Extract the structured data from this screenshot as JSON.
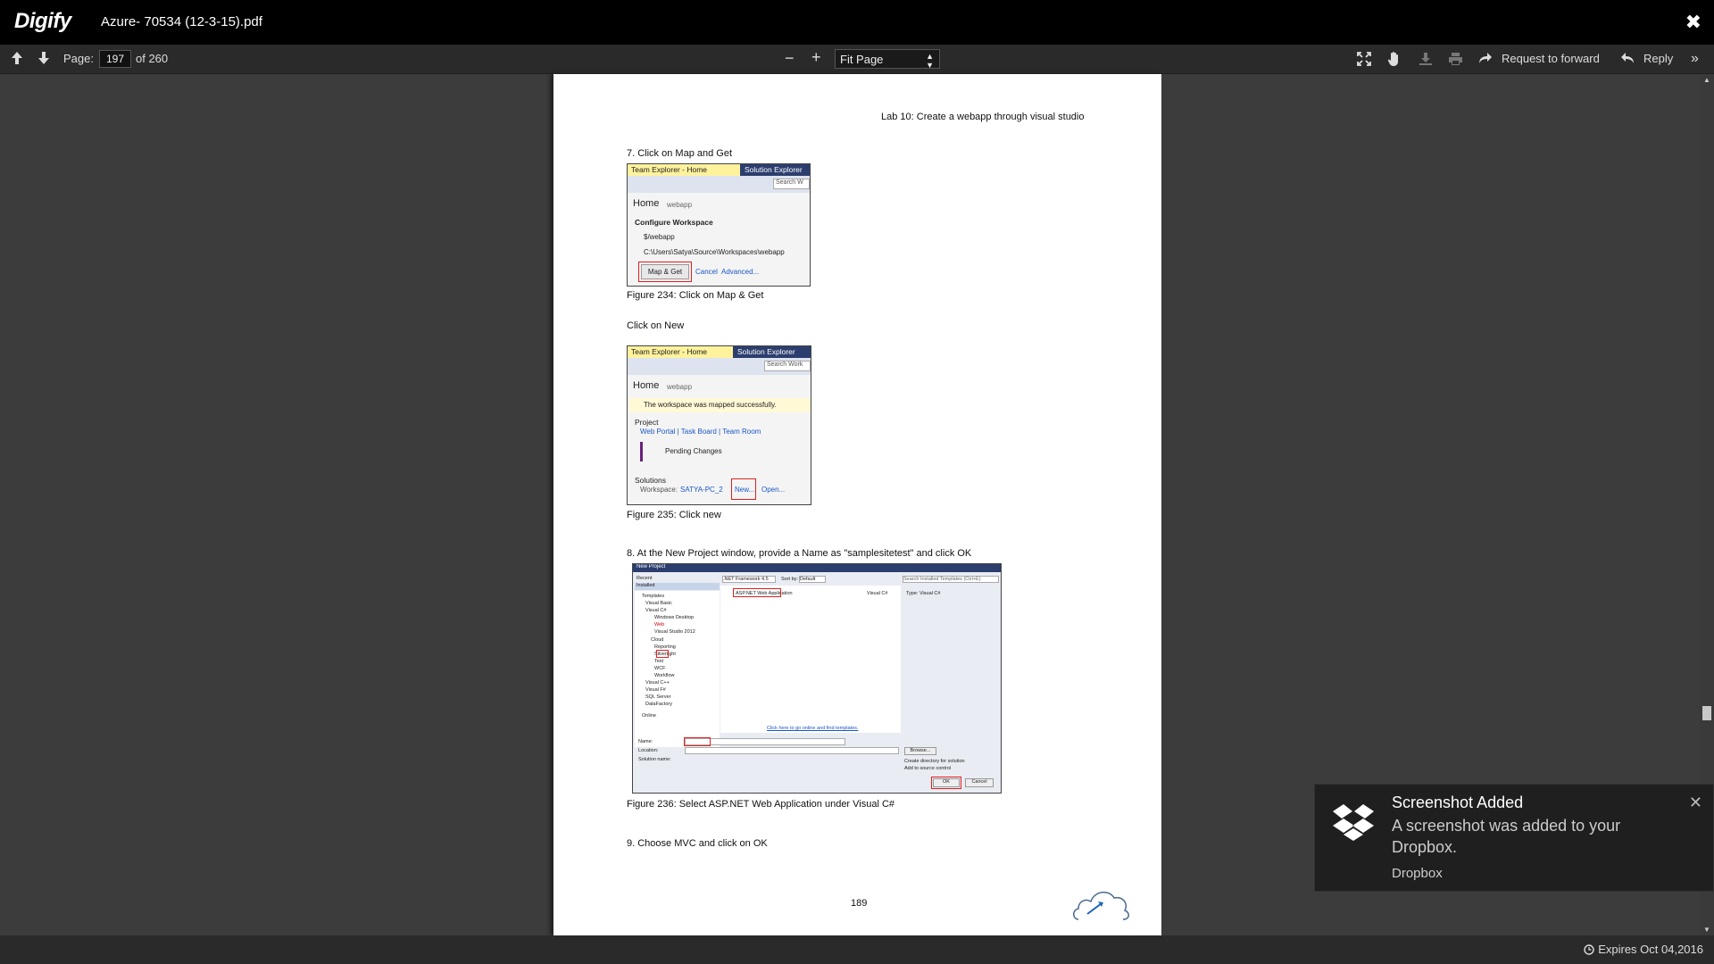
{
  "app": {
    "logo": "Digify",
    "file_title": "Azure- 70534 (12-3-15).pdf",
    "close_icon": "close-x-icon"
  },
  "toolbar": {
    "page_label": "Page:",
    "page_value": "197",
    "page_total": "of 260",
    "zoom_out": "−",
    "zoom_in": "+",
    "fit_mode": "Fit Page",
    "request_forward": "Request to forward",
    "reply": "Reply"
  },
  "document": {
    "header": "Lab 10: Create a webapp through visual studio",
    "step7": "7.    Click on Map and Get",
    "fig234": "Figure 234: Click on Map & Get",
    "click_new": "Click on New",
    "fig235": "Figure 235: Click new",
    "step8": "8.    At the New Project window, provide a Name as \"samplesitetest\" and click OK",
    "fig236": "Figure 236: Select ASP.NET Web Application under Visual C#",
    "step9": "9.    Choose MVC and click on OK",
    "page_number": "189",
    "shot1": {
      "tab_active": "Team Explorer - Home",
      "tab_other": "Solution Explorer",
      "search": "Search W",
      "home": "Home",
      "home_sub": "webapp",
      "section": "Configure Workspace",
      "path1": "$/webapp",
      "path2": "C:\\Users\\Satya\\Source\\Workspaces\\webapp",
      "btn": "Map & Get",
      "cancel": "Cancel",
      "advanced": "Advanced..."
    },
    "shot2": {
      "tab_active": "Team Explorer - Home",
      "tab_other": "Solution Explorer",
      "search": "Search Work",
      "home": "Home",
      "home_sub": "webapp",
      "info": "The workspace was mapped successfully.",
      "project": "Project",
      "links": "Web Portal | Task Board | Team Room",
      "pending": "Pending Changes",
      "solutions": "Solutions",
      "workspace_label": "Workspace:",
      "workspace_val": "SATYA-PC_2",
      "new": "New...",
      "open": "Open..."
    },
    "shot3": {
      "title": "New Project",
      "recent": "Recent",
      "installed": "Installed",
      "framework": ".NET Framework 4.5",
      "sort": "Sort by:",
      "sort_val": "Default",
      "search": "Search Installed Templates (Ctrl+E)",
      "template_sel": "ASP.NET Web Application",
      "template_lang": "Visual C#",
      "type_label": "Type: Visual C#",
      "tree": [
        "Templates",
        "Visual Basic",
        "Visual C#",
        "Windows Desktop",
        "Web",
        "Visual Studio 2012",
        "Cloud",
        "Reporting",
        "Silverlight",
        "Test",
        "WCF",
        "Workflow",
        "Visual C++",
        "Visual F#",
        "SQL Server",
        "DataFactory",
        "Online"
      ],
      "online_link": "Click here to go online and find templates.",
      "name_label": "Name:",
      "location_label": "Location:",
      "solution_label": "Solution name:",
      "browse": "Browse...",
      "create_dir": "Create directory for solution",
      "add_src": "Add to source control",
      "ok": "OK",
      "cancel": "Cancel"
    }
  },
  "toast": {
    "title": "Screenshot Added",
    "body": "A screenshot was added to your Dropbox.",
    "source": "Dropbox"
  },
  "status": {
    "expires": "Expires Oct 04,2016"
  }
}
